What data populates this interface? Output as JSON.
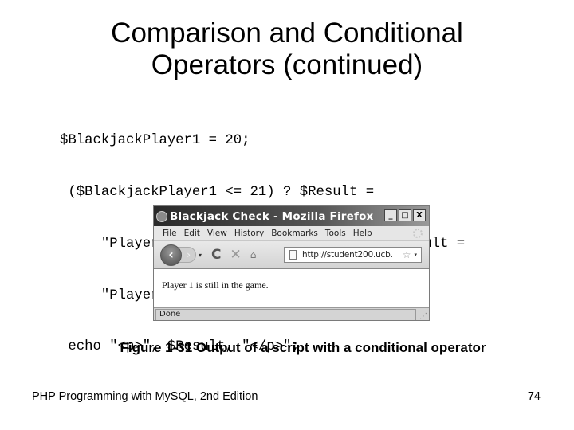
{
  "slide": {
    "title_lines": [
      "Comparison and Conditional",
      "Operators (continued)"
    ],
    "code_lines": [
      "$BlackjackPlayer1 = 20;",
      " ($BlackjackPlayer1 <= 21) ? $Result =",
      "     \"Player 1 is still in the game.\" : $Result =",
      "     \"Player 1 is out of the action.\";",
      " echo \"<p>\", $Result, \"</p>\";"
    ],
    "caption": "Figure 1-31  Output of a script with a conditional operator",
    "footer_left": "PHP Programming with MySQL, 2nd Edition",
    "page_number": "74"
  },
  "browser": {
    "window_title": "Blackjack Check - Mozilla Firefox",
    "window_buttons": {
      "minimize": "_",
      "maximize": "□",
      "close": "X"
    },
    "menu": [
      "File",
      "Edit",
      "View",
      "History",
      "Bookmarks",
      "Tools",
      "Help"
    ],
    "nav": {
      "back": "‹",
      "forward": "›",
      "history_dropdown": "▾",
      "reload": "C",
      "stop": "✕",
      "home": "⌂"
    },
    "url": "http://student200.ucb.",
    "url_star": "☆",
    "url_dropdown": "▾",
    "page_text": "Player 1 is still in the game.",
    "status": "Done",
    "resize_grip": "⋰"
  }
}
